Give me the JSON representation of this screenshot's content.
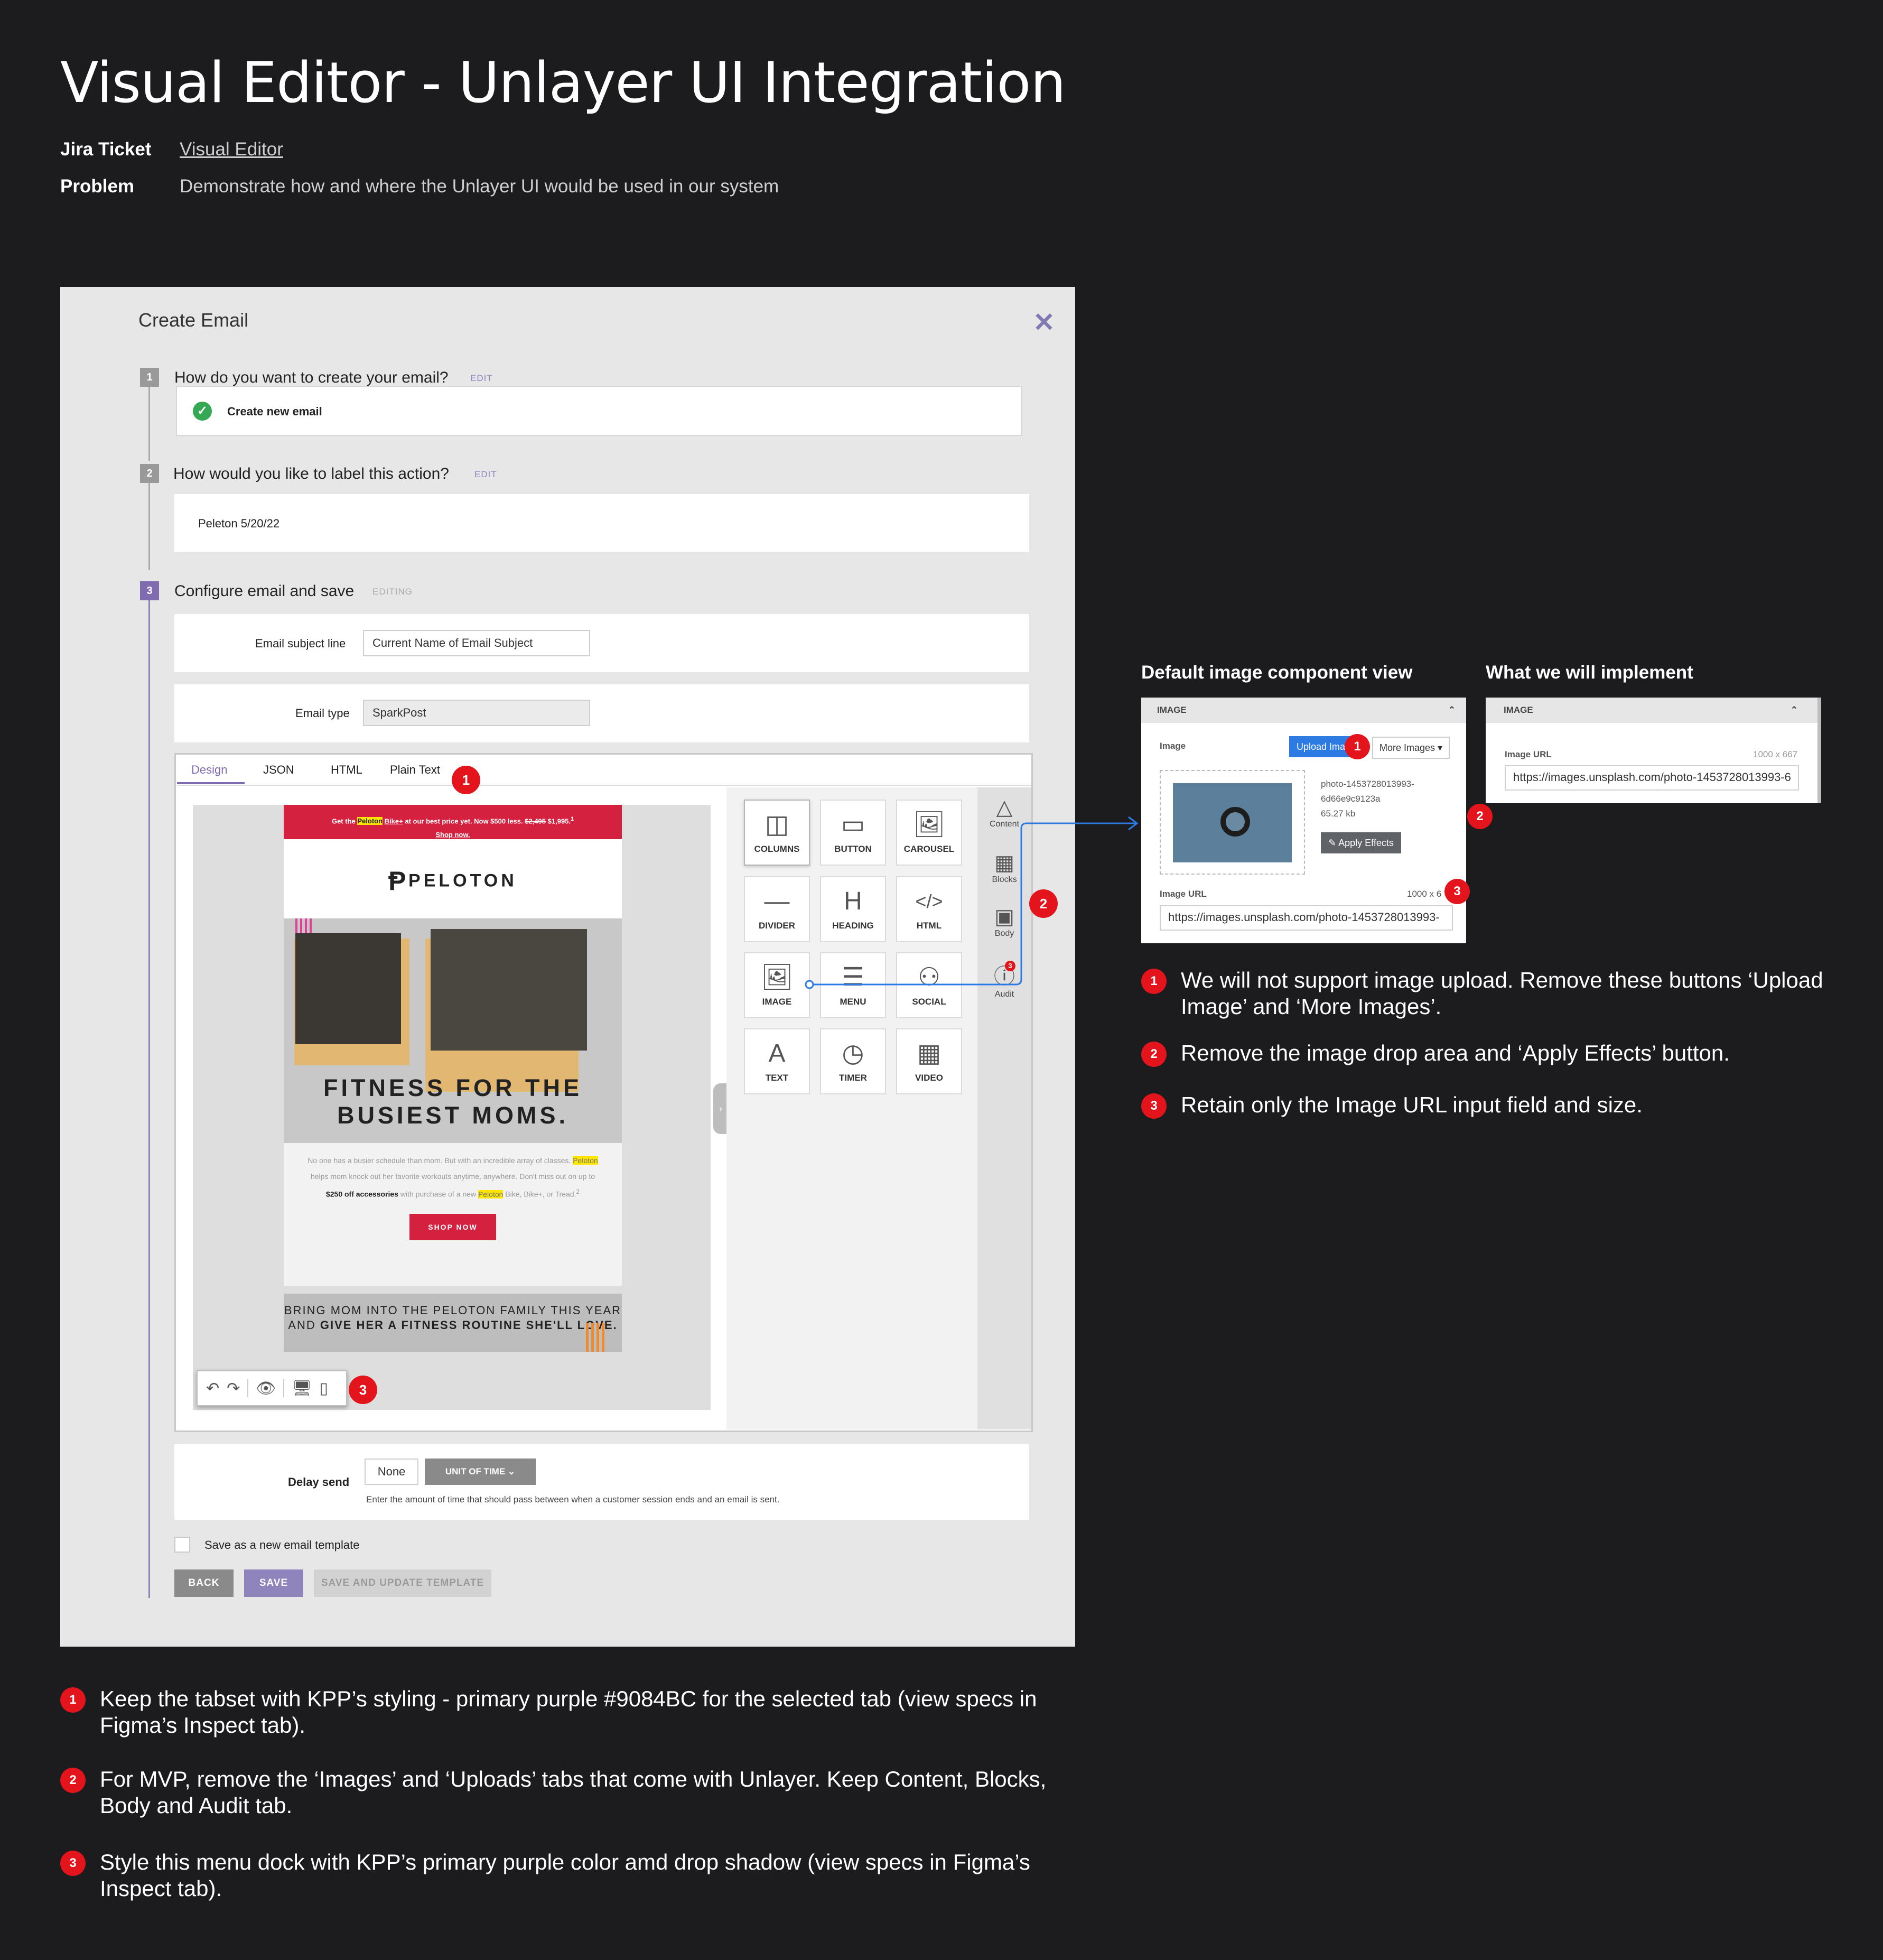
{
  "header": {
    "title": "Visual Editor - Unlayer UI Integration",
    "jira_label": "Jira Ticket",
    "jira_link": "Visual Editor",
    "problem_label": "Problem",
    "problem_text": "Demonstrate how and where the Unlayer UI would be used in our system"
  },
  "modal": {
    "title": "Create Email",
    "close_icon": "close-icon",
    "steps": [
      {
        "num": "1",
        "question": "How do you want to create your email?",
        "tag": "EDIT",
        "value": "Create new email"
      },
      {
        "num": "2",
        "question": "How would you like to label this action?",
        "tag": "EDIT",
        "value": "Peleton 5/20/22"
      },
      {
        "num": "3",
        "question": "Configure email and save",
        "tag": "EDITING"
      }
    ],
    "subject_label": "Email subject line",
    "subject_value": "Current Name of Email Subject",
    "type_label": "Email type",
    "type_value": "SparkPost",
    "editor_tabs": [
      "Design",
      "JSON",
      "HTML",
      "Plain Text"
    ],
    "selected_tab": "Design",
    "email_preview": {
      "banner_pre": "Get the",
      "banner_brand": "Peloton",
      "banner_product": "Bike+",
      "banner_mid": "at our best price yet. Now $500 less.",
      "banner_old_price": "$2,495",
      "banner_new_price": "$1,995.",
      "banner_sup": "1",
      "banner_cta": "Shop now.",
      "logo": "PELOTON",
      "headline": "FITNESS FOR THE BUSIEST MOMS.",
      "body_a": "No one has a busier schedule than mom. But with an incredible array of classes,",
      "body_brand_1": "Peloton",
      "body_b": "helps mom knock out her favorite workouts anytime, anywhere. Don't miss out on up to",
      "body_bold": "$250 off accessories",
      "body_c": "with purchase of a new",
      "body_brand_2": "Peloton",
      "body_d": "Bike, Bike+, or Tread.",
      "body_sup": "2",
      "cta": "SHOP NOW",
      "bottom_pre": "BRING MOM INTO THE PELOTON FAMILY THIS YEAR AND",
      "bottom_bold": "GIVE HER A FITNESS ROUTINE SHE'LL LOVE."
    },
    "dock_icons": [
      "undo-icon",
      "redo-icon",
      "preview-eye-icon",
      "desktop-icon",
      "mobile-icon"
    ],
    "content_tiles": [
      {
        "label": "COLUMNS",
        "icon": "columns-icon",
        "glyph": "◫"
      },
      {
        "label": "BUTTON",
        "icon": "button-icon",
        "glyph": "▭"
      },
      {
        "label": "CAROUSEL",
        "icon": "carousel-icon",
        "glyph": "🖼"
      },
      {
        "label": "DIVIDER",
        "icon": "divider-icon",
        "glyph": "—"
      },
      {
        "label": "HEADING",
        "icon": "heading-icon",
        "glyph": "H"
      },
      {
        "label": "HTML",
        "icon": "html-icon",
        "glyph": "</>"
      },
      {
        "label": "IMAGE",
        "icon": "image-icon",
        "glyph": "🖼"
      },
      {
        "label": "MENU",
        "icon": "menu-icon",
        "glyph": "☰"
      },
      {
        "label": "SOCIAL",
        "icon": "social-icon",
        "glyph": "⚇"
      },
      {
        "label": "TEXT",
        "icon": "text-icon",
        "glyph": "A"
      },
      {
        "label": "TIMER",
        "icon": "timer-icon",
        "glyph": "◷"
      },
      {
        "label": "VIDEO",
        "icon": "video-icon",
        "glyph": "▦"
      }
    ],
    "side_tabs": [
      {
        "label": "Content",
        "icon": "shapes-icon",
        "glyph": "△"
      },
      {
        "label": "Blocks",
        "icon": "blocks-icon",
        "glyph": "▦"
      },
      {
        "label": "Body",
        "icon": "body-icon",
        "glyph": "▣"
      },
      {
        "label": "Audit",
        "icon": "audit-icon",
        "glyph": "ⓘ"
      }
    ],
    "audit_badge": "3",
    "delay_label": "Delay send",
    "delay_value": "None",
    "delay_unit": "UNIT OF TIME",
    "delay_help": "Enter the amount of time that should pass between when a customer session ends and an email is sent.",
    "save_template_label": "Save as a new email template",
    "buttons": {
      "back": "BACK",
      "save": "SAVE",
      "save_update": "SAVE AND UPDATE TEMPLATE"
    }
  },
  "markers": {
    "one": "1",
    "two": "2",
    "three": "3"
  },
  "bottom_notes": [
    "Keep the tabset with KPP’s styling - primary purple #9084BC for the selected tab (view specs in Figma’s Inspect tab).",
    "For MVP, remove the ‘Images’ and ‘Uploads’ tabs that come with Unlayer. Keep Content, Blocks, Body and Audit tab.",
    "Style this menu dock with KPP’s primary purple color amd drop shadow (view specs in Figma’s Inspect tab)."
  ],
  "right": {
    "default_heading": "Default image component view",
    "implement_heading": "What we will implement",
    "default_card": {
      "header": "IMAGE",
      "image_label": "Image",
      "upload_btn": "Upload Ima",
      "more_btn": "More Images",
      "file_name_1": "photo-1453728013993-",
      "file_name_2": "6d66e9c9123a",
      "file_size": "65.27 kb",
      "effects_btn": "Apply Effects",
      "url_label": "Image URL",
      "url_size": "1000 x 6",
      "url_value": "https://images.unsplash.com/photo-1453728013993-"
    },
    "impl_card": {
      "header": "IMAGE",
      "url_label": "Image URL",
      "url_size": "1000 x 667",
      "url_value": "https://images.unsplash.com/photo-1453728013993-6"
    },
    "notes": [
      "We will not support image upload. Remove these buttons ‘Upload Image’ and ‘More Images’.",
      "Remove the image drop area and ‘Apply Effects’ button.",
      "Retain only the Image URL input field and size."
    ]
  },
  "colors": {
    "primary_purple": "#9084BC",
    "marker_red": "#E3141C",
    "peloton_red": "#D42140",
    "background": "#1C1B1D"
  }
}
